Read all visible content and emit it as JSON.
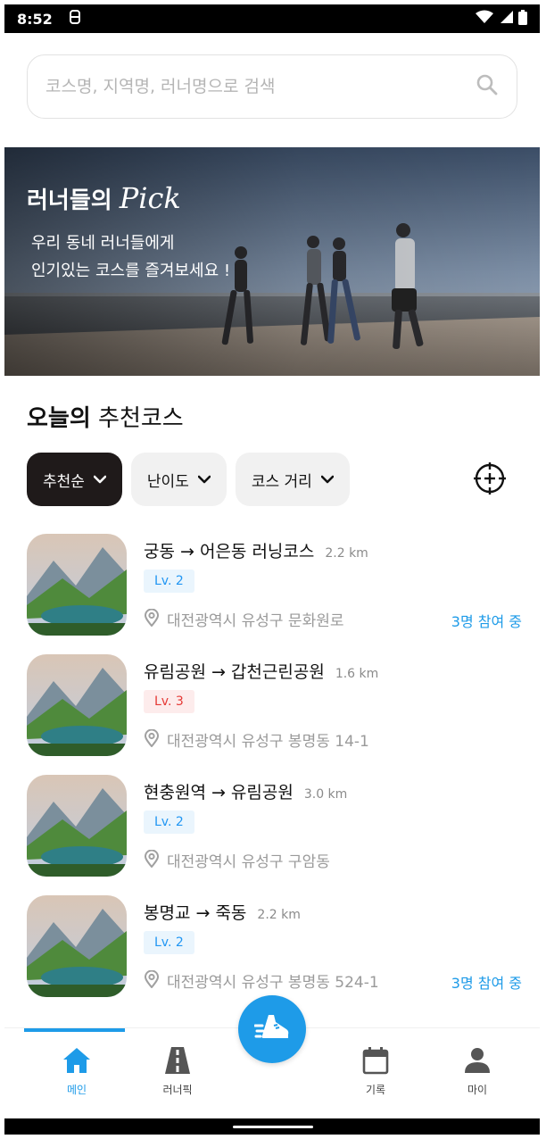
{
  "status_bar": {
    "time": "8:52"
  },
  "search": {
    "placeholder": "코스명, 지역명, 러너명으로 검색"
  },
  "banner": {
    "title_main": "러너들의",
    "title_script": "Pick",
    "desc_line1": "우리 동네 러너들에게",
    "desc_line2": "인기있는 코스를 즐겨보세요 !"
  },
  "section": {
    "title_bold": "오늘의",
    "title_rest": "추천코스"
  },
  "filters": [
    {
      "label": "추천순",
      "active": true
    },
    {
      "label": "난이도",
      "active": false
    },
    {
      "label": "코스 거리",
      "active": false
    }
  ],
  "courses": [
    {
      "name": "궁동 → 어은동 러닝코스",
      "distance": "2.2 km",
      "level": "Lv. 2",
      "level_color": "#2196f3",
      "address": "대전광역시 유성구 문화원로",
      "participants": "3명 참여 중"
    },
    {
      "name": "유림공원 → 갑천근린공원",
      "distance": "1.6 km",
      "level": "Lv. 3",
      "level_color": "#e53935",
      "address": "대전광역시 유성구 봉명동 14-1",
      "participants": ""
    },
    {
      "name": "현충원역 → 유림공원",
      "distance": "3.0 km",
      "level": "Lv. 2",
      "level_color": "#2196f3",
      "address": "대전광역시 유성구 구암동",
      "participants": ""
    },
    {
      "name": "봉명교 → 죽동",
      "distance": "2.2 km",
      "level": "Lv. 2",
      "level_color": "#2196f3",
      "address": "대전광역시 유성구 봉명동 524-1",
      "participants": "3명 참여 중"
    }
  ],
  "bottom_nav": [
    {
      "label": "메인",
      "icon": "home-icon",
      "active": true
    },
    {
      "label": "러너픽",
      "icon": "road-icon",
      "active": false
    },
    {
      "label": "기록",
      "icon": "calendar-icon",
      "active": false
    },
    {
      "label": "마이",
      "icon": "person-icon",
      "active": false
    }
  ],
  "colors": {
    "accent": "#1e9be8",
    "chip_active": "#1f1a1a",
    "chip": "#f1f1f1"
  }
}
